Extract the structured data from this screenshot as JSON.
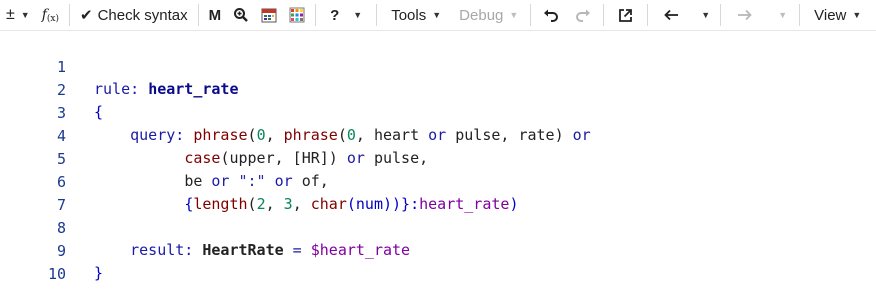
{
  "toolbar": {
    "plusminus": "±",
    "fx_main": "f",
    "fx_sub": "(x)",
    "check_syntax": "Check syntax",
    "m_label": "M",
    "help_label": "?",
    "tools_label": "Tools",
    "debug_label": "Debug",
    "view_label": "View"
  },
  "editor": {
    "line_numbers": [
      "1",
      "2",
      "3",
      "4",
      "5",
      "6",
      "7",
      "8",
      "9",
      "10"
    ],
    "l1": {
      "a": "rule:",
      "b": "heart_rate"
    },
    "l2": {
      "a": "{"
    },
    "l3": {
      "a": "query:",
      "b": "phrase",
      "c": "(",
      "d": "0",
      ",": ", ",
      "e": "phrase",
      "f": "(",
      "g": "0",
      "h": ", heart ",
      "i": "or",
      "j": " pulse, rate) ",
      "k": "or"
    },
    "l4": {
      "a": "case",
      "b": "(upper, [HR]) ",
      "c": "or",
      "d": " pulse,"
    },
    "l5": {
      "a": "be ",
      "b": "or",
      "c": " \":\" ",
      "d": "or",
      "e": " of,"
    },
    "l6": {
      "a": "{",
      "b": "length",
      "c": "(",
      "d": "2",
      ",": ", ",
      "e": "3",
      "f": ", ",
      "g": "char",
      "h": "(num))}:",
      "i": "heart_rate",
      "j": ")"
    },
    "l8": {
      "a": "result:",
      "b": "HeartRate",
      "c": " = ",
      "d": "$heart_rate"
    },
    "l9": {
      "a": "}"
    }
  },
  "colors": {
    "keyword": "#1a1aa6",
    "function": "#800000",
    "number": "#098658",
    "variable": "#8000a0",
    "line_number": "#1a3a8f"
  }
}
